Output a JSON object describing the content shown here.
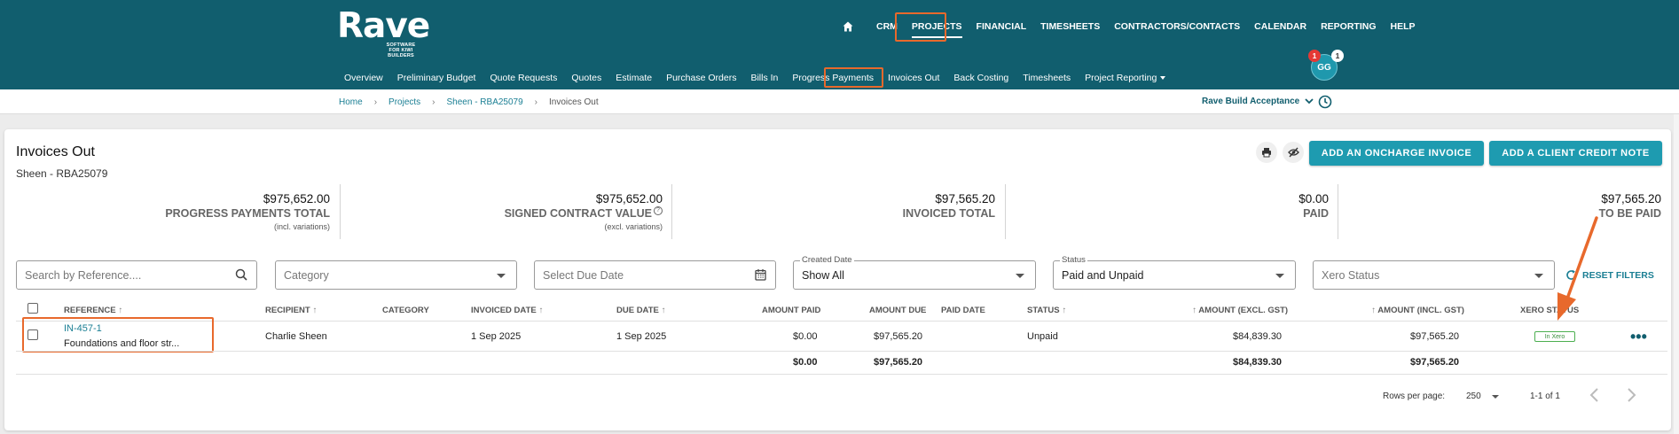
{
  "brand": {
    "logo_text": "Rave",
    "logo_tagline": "SOFTWARE FOR KIWI BUILDERS"
  },
  "main_nav": [
    "CRM",
    "PROJECTS",
    "FINANCIAL",
    "TIMESHEETS",
    "CONTRACTORS/CONTACTS",
    "CALENDAR",
    "REPORTING",
    "HELP"
  ],
  "sub_nav": [
    "Overview",
    "Preliminary Budget",
    "Quote Requests",
    "Quotes",
    "Estimate",
    "Purchase Orders",
    "Bills In",
    "Progress Payments",
    "Invoices Out",
    "Back Costing",
    "Timesheets",
    "Project Reporting"
  ],
  "user": {
    "initials": "GG",
    "badge_left": "1",
    "badge_right": "1"
  },
  "breadcrumb": [
    "Home",
    "Projects",
    "Sheen - RBA25079",
    "Invoices Out"
  ],
  "workflow_label": "Rave Build Acceptance",
  "page": {
    "title": "Invoices Out",
    "subtitle": "Sheen - RBA25079"
  },
  "actions": {
    "oncharge": "ADD AN ONCHARGE INVOICE",
    "credit_note": "ADD A CLIENT CREDIT NOTE"
  },
  "summary": [
    {
      "value": "$975,652.00",
      "label": "PROGRESS PAYMENTS TOTAL",
      "note": "(incl. variations)"
    },
    {
      "value": "$975,652.00",
      "label": "SIGNED CONTRACT VALUE",
      "note": "(excl. variations)"
    },
    {
      "value": "$97,565.20",
      "label": "INVOICED TOTAL",
      "note": ""
    },
    {
      "value": "$0.00",
      "label": "PAID",
      "note": ""
    },
    {
      "value": "$97,565.20",
      "label": "TO BE PAID",
      "note": ""
    }
  ],
  "filters": {
    "search_placeholder": "Search by Reference....",
    "category_placeholder": "Category",
    "due_date_placeholder": "Select Due Date",
    "created_date_label": "Created Date",
    "created_date_value": "Show All",
    "status_label": "Status",
    "status_value": "Paid and Unpaid",
    "xero_placeholder": "Xero Status",
    "reset": "RESET FILTERS"
  },
  "table": {
    "headers": {
      "reference": "REFERENCE",
      "recipient": "RECIPIENT",
      "category": "CATEGORY",
      "invoiced_date": "INVOICED DATE",
      "due_date": "DUE DATE",
      "amount_paid": "AMOUNT PAID",
      "amount_due": "AMOUNT DUE",
      "paid_date": "PAID DATE",
      "status": "STATUS",
      "amount_excl": "AMOUNT (EXCL. GST)",
      "amount_incl": "AMOUNT (INCL. GST)",
      "xero_status": "XERO STATUS"
    },
    "row": {
      "reference": "IN-457-1",
      "description": "Foundations and floor str...",
      "recipient": "Charlie Sheen",
      "category": "",
      "invoiced_date": "1 Sep 2025",
      "due_date": "1 Sep 2025",
      "amount_paid": "$0.00",
      "amount_due": "$97,565.20",
      "paid_date": "",
      "status": "Unpaid",
      "amount_excl": "$84,839.30",
      "amount_incl": "$97,565.20",
      "xero_status": "In Xero"
    },
    "totals": {
      "amount_paid": "$0.00",
      "amount_due": "$97,565.20",
      "amount_excl": "$84,839.30",
      "amount_incl": "$97,565.20"
    }
  },
  "pagination": {
    "rows_label": "Rows per page:",
    "rows_value": "250",
    "range": "1-1 of 1"
  },
  "colors": {
    "header": "#115e6e",
    "accent": "#1e9bb0",
    "highlight": "#e8692c",
    "link": "#1b7f94"
  }
}
